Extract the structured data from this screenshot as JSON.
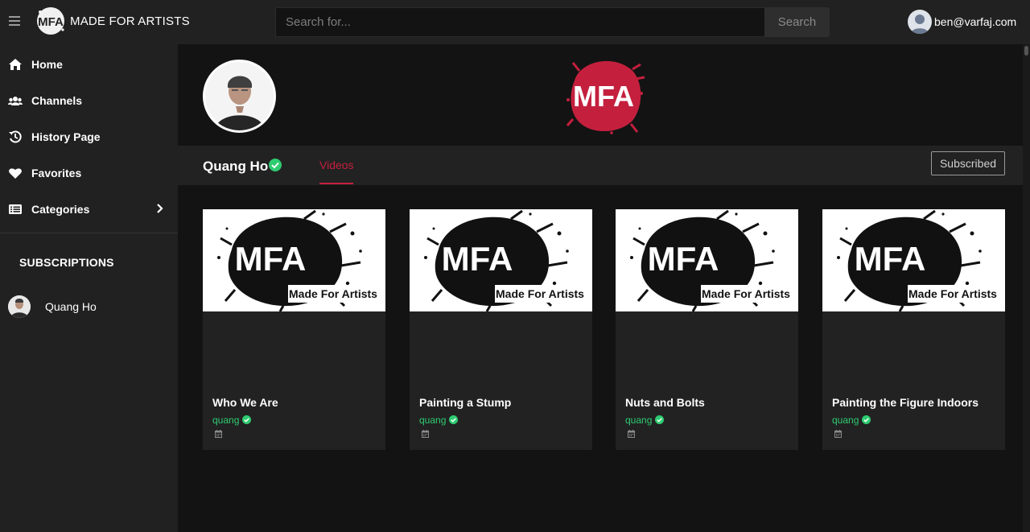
{
  "header": {
    "brand_name": "MADE FOR ARTISTS",
    "brand_logo_text": "MFA",
    "search_placeholder": "Search for...",
    "search_button": "Search",
    "user_email": "ben@varfaj.com"
  },
  "sidebar": {
    "items": [
      {
        "label": "Home",
        "icon": "home-icon"
      },
      {
        "label": "Channels",
        "icon": "users-icon"
      },
      {
        "label": "History Page",
        "icon": "history-icon"
      },
      {
        "label": "Favorites",
        "icon": "heart-icon"
      },
      {
        "label": "Categories",
        "icon": "list-icon"
      }
    ],
    "subscriptions_title": "SUBSCRIPTIONS",
    "subscriptions": [
      {
        "name": "Quang Ho"
      }
    ]
  },
  "channel": {
    "banner_logo_text": "MFA",
    "name": "Quang Ho",
    "tab": "Videos",
    "subscribe_label": "Subscribed"
  },
  "videos": [
    {
      "title": "Who We Are",
      "author": "quang"
    },
    {
      "title": "Painting a Stump",
      "author": "quang"
    },
    {
      "title": "Nuts and Bolts",
      "author": "quang"
    },
    {
      "title": "Painting the Figure Indoors",
      "author": "quang"
    }
  ],
  "thumbnail": {
    "logo_text": "MFA",
    "tagline": "Made For Artists"
  },
  "colors": {
    "accent": "#c4203e",
    "verified": "#2ecc71",
    "background": "#131313",
    "panel": "#212121"
  }
}
